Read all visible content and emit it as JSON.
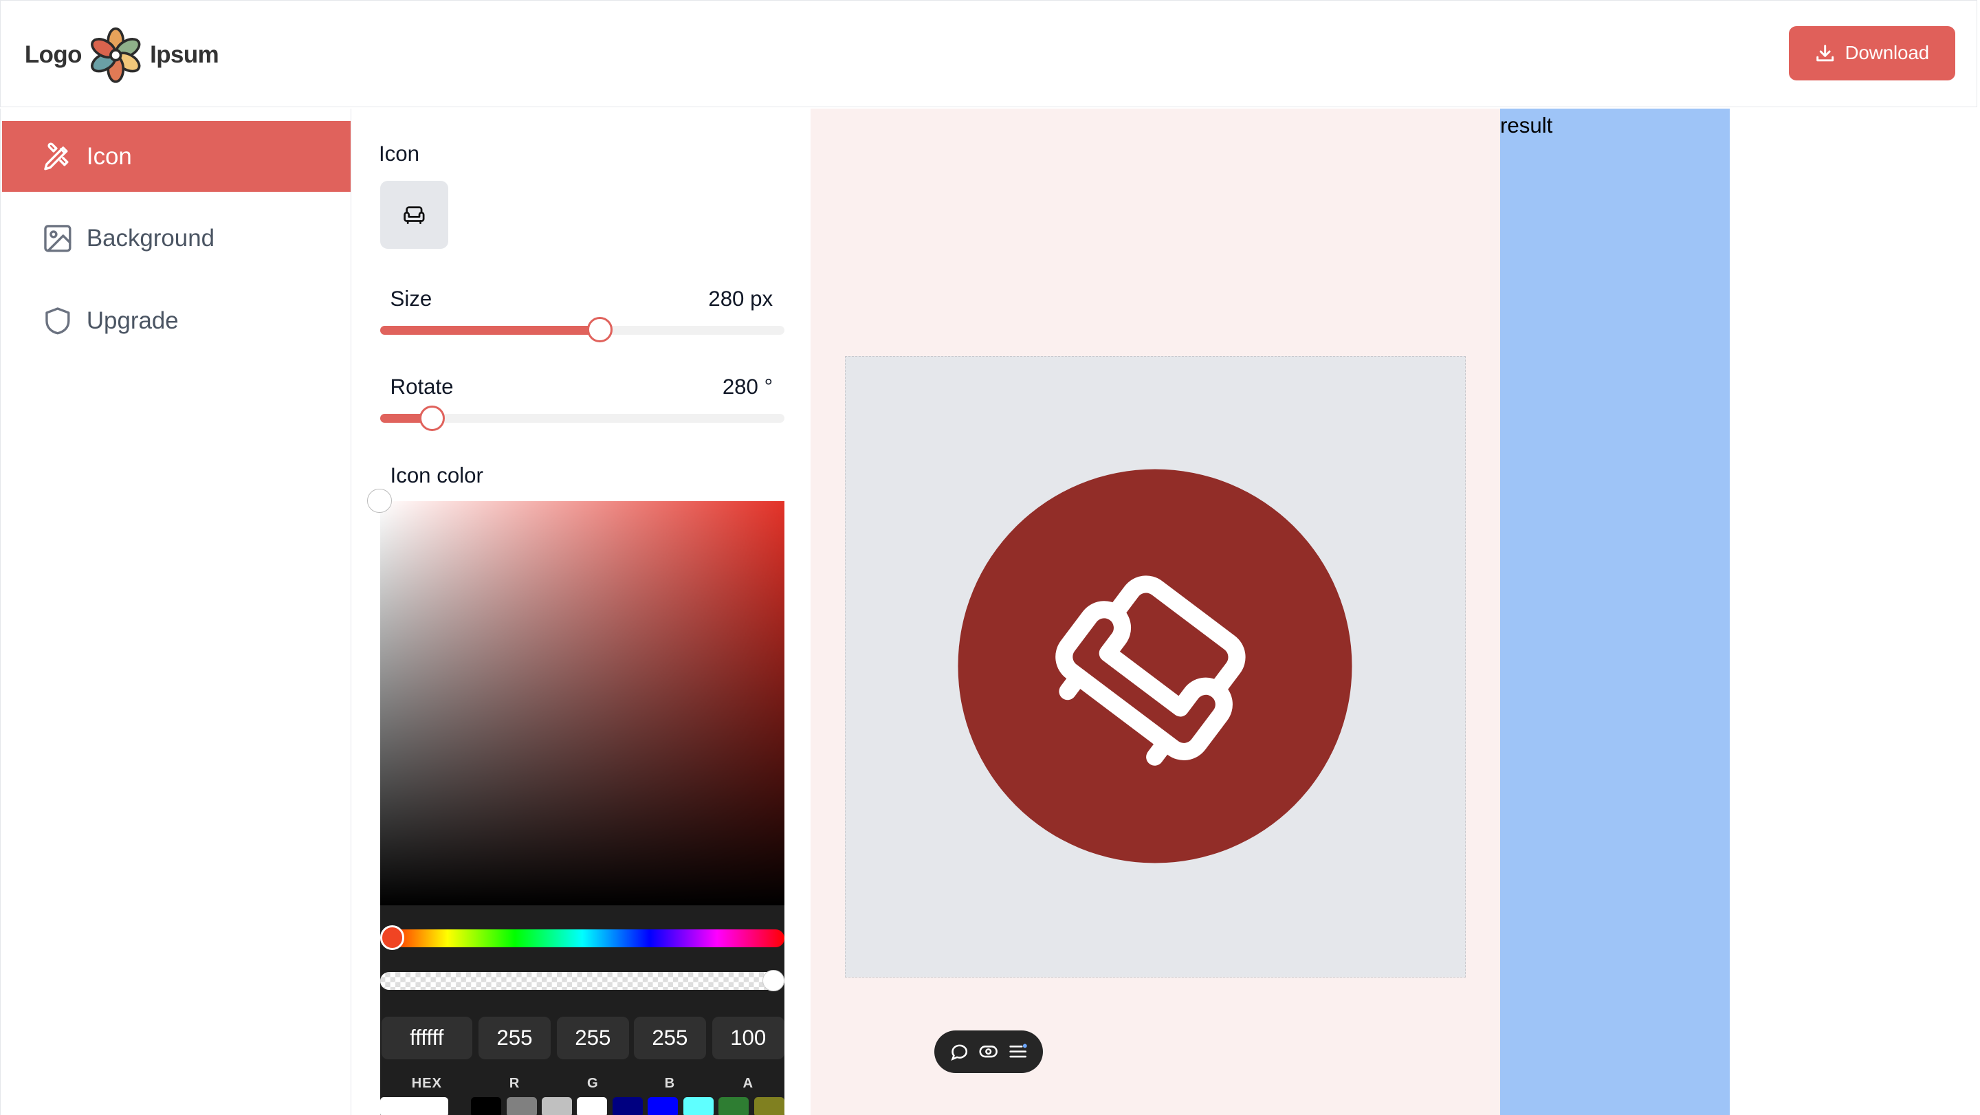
{
  "brand": {
    "left": "Logo",
    "right": "Ipsum"
  },
  "header": {
    "download_label": "Download"
  },
  "sidebar": {
    "items": [
      {
        "label": "Icon",
        "icon": "brush-pencil-icon",
        "active": true
      },
      {
        "label": "Background",
        "icon": "image-icon",
        "active": false
      },
      {
        "label": "Upgrade",
        "icon": "shield-icon",
        "active": false
      }
    ]
  },
  "panel": {
    "icon_label": "Icon",
    "selected_icon": "sofa-icon",
    "size": {
      "label": "Size",
      "value": "280 px",
      "fraction": 0.545
    },
    "rotate": {
      "label": "Rotate",
      "value": "280 °",
      "fraction": 0.13
    },
    "color_label": "Icon color"
  },
  "picker": {
    "hue_color": "#e33228",
    "hex": {
      "value": "ffffff",
      "label": "HEX"
    },
    "r": {
      "value": "255",
      "label": "R"
    },
    "g": {
      "value": "255",
      "label": "G"
    },
    "b": {
      "value": "255",
      "label": "B"
    },
    "a": {
      "value": "100",
      "label": "A"
    },
    "swatches": [
      "#ffffff",
      "#000000",
      "#808080",
      "#c0c0c0",
      "#ffffff",
      "#000080",
      "#0000ff",
      "#5fffff",
      "#2e7d32",
      "#808020"
    ]
  },
  "preview": {
    "icon_bg_color": "#922d28",
    "icon_fg_color": "#ffffff",
    "canvas_color": "#e5e7eb",
    "toolbar_icons": [
      "comment-icon",
      "eye-icon",
      "list-icon"
    ]
  },
  "result": {
    "label": "result"
  },
  "colors": {
    "accent": "#e0625c",
    "result_bg": "#9ec4f7",
    "preview_bg": "#fbf0ef"
  }
}
